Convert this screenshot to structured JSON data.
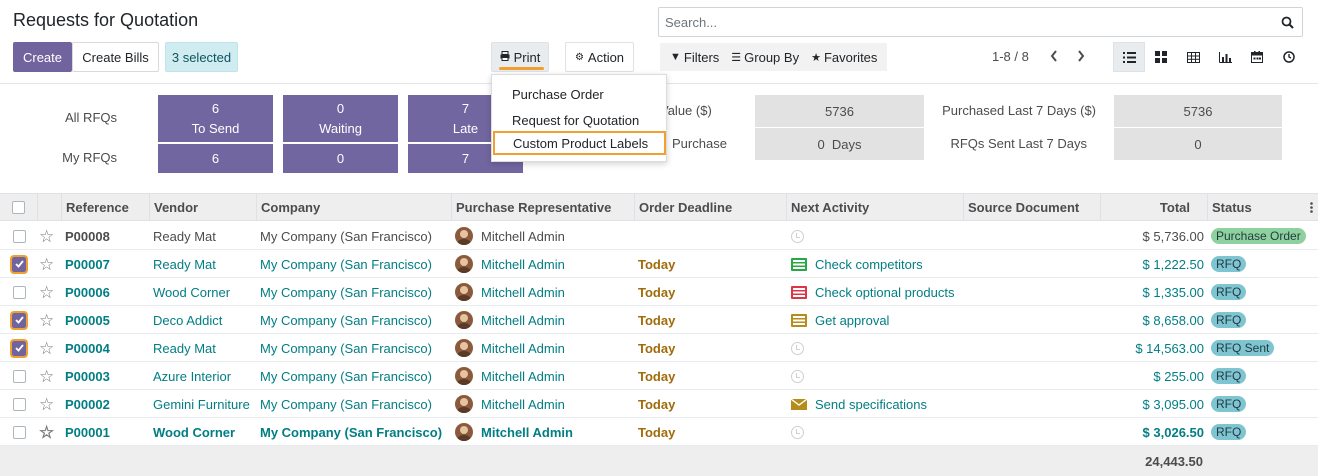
{
  "page": {
    "title": "Requests for Quotation"
  },
  "toolbar": {
    "create": "Create",
    "create_bills": "Create Bills",
    "selected": "3 selected",
    "print": "Print",
    "action": "Action"
  },
  "search": {
    "placeholder": "Search..."
  },
  "filters": {
    "filters": "Filters",
    "group_by": "Group By",
    "favorites": "Favorites"
  },
  "pager": {
    "text": "1-8 / 8"
  },
  "print_menu": {
    "items": [
      "Purchase Order",
      "Request for Quotation",
      "Custom Product Labels"
    ],
    "highlighted": "Custom Product Labels"
  },
  "dashboard": {
    "row_labels": [
      "All RFQs",
      "My RFQs"
    ],
    "tiles_all": [
      {
        "count": "6",
        "label": "To Send"
      },
      {
        "count": "0",
        "label": "Waiting"
      },
      {
        "count": "7",
        "label": "Late"
      }
    ],
    "tiles_my": [
      "6",
      "0",
      "7"
    ],
    "stats": {
      "avg_value_label": "Value ($)",
      "avg_value": "5736",
      "purchased_7d_label": "Purchased Last 7 Days ($)",
      "purchased_7d": "5736",
      "lead_label": "Purchase",
      "lead_value": "0  Days",
      "sent_7d_label": "RFQs Sent Last 7 Days",
      "sent_7d": "0"
    }
  },
  "table": {
    "columns": [
      "Reference",
      "Vendor",
      "Company",
      "Purchase Representative",
      "Order Deadline",
      "Next Activity",
      "Source Document",
      "Total",
      "Status"
    ],
    "rows": [
      {
        "ref": "P00008",
        "vendor": "Ready Mat",
        "company": "My Company (San Francisco)",
        "rep": "Mitchell Admin",
        "deadline": "",
        "activity": "",
        "activity_icon": "clock",
        "total": "$ 5,736.00",
        "status": "Purchase Order",
        "checked": false
      },
      {
        "ref": "P00007",
        "vendor": "Ready Mat",
        "company": "My Company (San Francisco)",
        "rep": "Mitchell Admin",
        "deadline": "Today",
        "activity": "Check competitors",
        "activity_icon": "green-list",
        "total": "$ 1,222.50",
        "status": "RFQ",
        "checked": true
      },
      {
        "ref": "P00006",
        "vendor": "Wood Corner",
        "company": "My Company (San Francisco)",
        "rep": "Mitchell Admin",
        "deadline": "Today",
        "activity": "Check optional products",
        "activity_icon": "red-list",
        "total": "$ 1,335.00",
        "status": "RFQ",
        "checked": false
      },
      {
        "ref": "P00005",
        "vendor": "Deco Addict",
        "company": "My Company (San Francisco)",
        "rep": "Mitchell Admin",
        "deadline": "Today",
        "activity": "Get approval",
        "activity_icon": "gold-list",
        "total": "$ 8,658.00",
        "status": "RFQ",
        "checked": true
      },
      {
        "ref": "P00004",
        "vendor": "Ready Mat",
        "company": "My Company (San Francisco)",
        "rep": "Mitchell Admin",
        "deadline": "Today",
        "activity": "",
        "activity_icon": "clock",
        "total": "$ 14,563.00",
        "status": "RFQ Sent",
        "checked": true
      },
      {
        "ref": "P00003",
        "vendor": "Azure Interior",
        "company": "My Company (San Francisco)",
        "rep": "Mitchell Admin",
        "deadline": "Today",
        "activity": "",
        "activity_icon": "clock",
        "total": "$ 255.00",
        "status": "RFQ",
        "checked": false
      },
      {
        "ref": "P00002",
        "vendor": "Gemini Furniture",
        "company": "My Company (San Francisco)",
        "rep": "Mitchell Admin",
        "deadline": "Today",
        "activity": "Send specifications",
        "activity_icon": "envelope",
        "total": "$ 3,095.00",
        "status": "RFQ",
        "checked": false
      },
      {
        "ref": "P00001",
        "vendor": "Wood Corner",
        "company": "My Company (San Francisco)",
        "rep": "Mitchell Admin",
        "deadline": "Today",
        "activity": "",
        "activity_icon": "clock",
        "total": "$ 3,026.50",
        "status": "RFQ",
        "checked": false
      }
    ],
    "grand_total": "24,443.50"
  },
  "colors": {
    "primary": "#71639e",
    "highlight": "#f0a02e",
    "link": "#017e84",
    "today": "#a06b08",
    "status_po": "#8fd19e",
    "status_rfq": "#7fc4d1"
  }
}
